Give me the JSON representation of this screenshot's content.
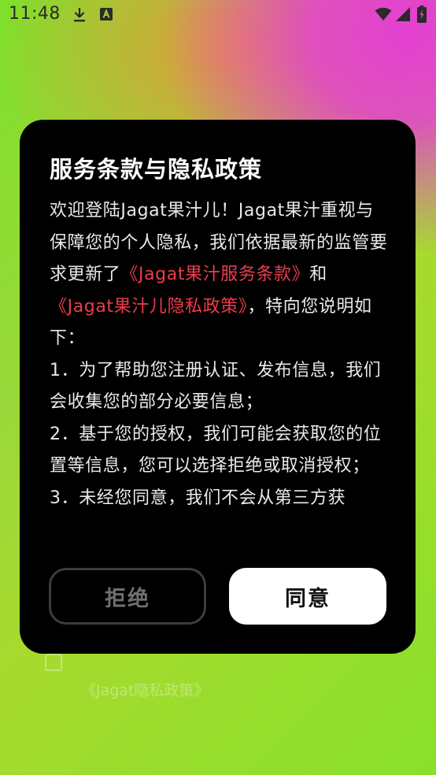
{
  "status_bar": {
    "time": "11:48"
  },
  "dialog": {
    "title": "服务条款与隐私政策",
    "intro_1": "欢迎登陆Jagat果汁儿！Jagat果汁重视与保障您的个人隐私，我们依据最新的监管要求更新了",
    "link_terms": "《Jagat果汁服务条款》",
    "and": "和",
    "link_privacy": "《Jagat果汁儿隐私政策》",
    "intro_2": "，特向您说明如下：",
    "item_1": "1．为了帮助您注册认证、发布信息，我们会收集您的部分必要信息；",
    "item_2": "2．基于您的授权，我们可能会获取您的位置等信息，您可以选择拒绝或取消授权；",
    "item_3": "3．未经您同意，我们不会从第三方获",
    "reject_label": "拒绝",
    "agree_label": "同意"
  },
  "background": {
    "privacy_link": "《Jagat隐私政策》"
  },
  "colors": {
    "link": "#ee3c4a",
    "dialog_bg": "#000000"
  }
}
